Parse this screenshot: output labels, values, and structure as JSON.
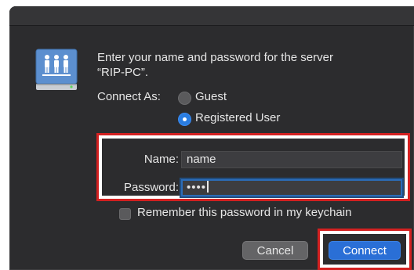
{
  "dialog": {
    "prompt_line1": "Enter your name and password for the server",
    "prompt_line2": "“RIP-PC”.",
    "connect_as_label": "Connect As:",
    "options": {
      "guest": "Guest",
      "registered": "Registered User",
      "selected": "Registered User"
    },
    "name_label": "Name:",
    "name_value": "name",
    "password_label": "Password:",
    "password_masked": "••••",
    "remember_label": "Remember this password in my keychain",
    "remember_checked": false,
    "cancel_label": "Cancel",
    "connect_label": "Connect"
  },
  "icons": {
    "server": "network-server-icon"
  },
  "colors": {
    "dialog_bg": "#2c2c2e",
    "accent": "#2a6fd6",
    "highlight": "#d32020"
  }
}
